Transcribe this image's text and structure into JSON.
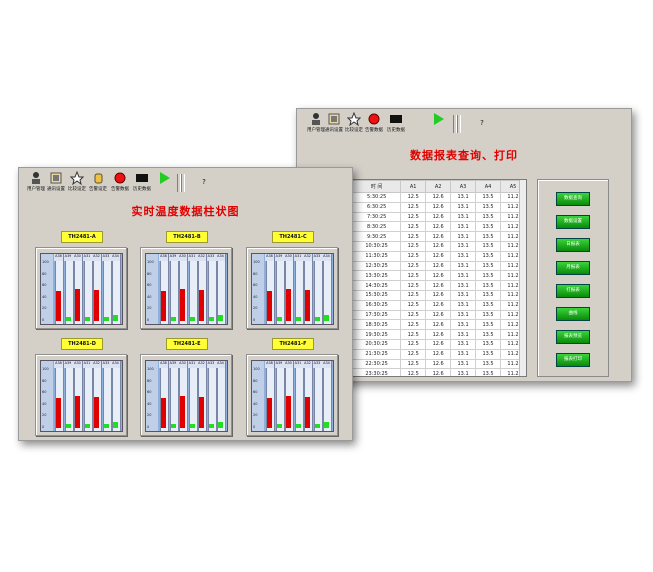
{
  "toolbar_back": {
    "buttons": [
      {
        "label": "用户管理",
        "icon": "user-icon"
      },
      {
        "label": "通讯设置",
        "icon": "comm-settings-icon"
      },
      {
        "label": "比较设定",
        "icon": "star-icon"
      },
      {
        "label": "告警数据",
        "icon": "alarm-icon"
      },
      {
        "label": "历史数据",
        "icon": "history-icon"
      }
    ]
  },
  "toolbar_front": {
    "buttons": [
      {
        "label": "用户管理",
        "icon": "user-icon"
      },
      {
        "label": "通讯设置",
        "icon": "comm-settings-icon"
      },
      {
        "label": "比较设定",
        "icon": "star-icon"
      },
      {
        "label": "告警设定",
        "icon": "hand-icon"
      },
      {
        "label": "告警数据",
        "icon": "alarm-icon"
      },
      {
        "label": "历史数据",
        "icon": "history-icon"
      }
    ],
    "help": "?"
  },
  "report": {
    "title": "数据报表查询、打印",
    "columns": [
      "时 间",
      "A1",
      "A2",
      "A3",
      "A4",
      "A5"
    ],
    "rows": [
      [
        "5:30:25",
        "12.5",
        "12.6",
        "13.1",
        "13.5",
        "11.2"
      ],
      [
        "6:30:25",
        "12.5",
        "12.6",
        "13.1",
        "13.5",
        "11.2"
      ],
      [
        "7:30:25",
        "12.5",
        "12.6",
        "13.1",
        "13.5",
        "11.2"
      ],
      [
        "8:30:25",
        "12.5",
        "12.6",
        "13.1",
        "13.5",
        "11.2"
      ],
      [
        "9:30:25",
        "12.5",
        "12.6",
        "13.1",
        "13.5",
        "11.2"
      ],
      [
        "10:30:25",
        "12.5",
        "12.6",
        "13.1",
        "13.5",
        "11.2"
      ],
      [
        "11:30:25",
        "12.5",
        "12.6",
        "13.1",
        "13.5",
        "11.2"
      ],
      [
        "12:30:25",
        "12.5",
        "12.6",
        "13.1",
        "13.5",
        "11.2"
      ],
      [
        "13:30:25",
        "12.5",
        "12.6",
        "13.1",
        "13.5",
        "11.2"
      ],
      [
        "14:30:25",
        "12.5",
        "12.6",
        "13.1",
        "13.5",
        "11.2"
      ],
      [
        "15:30:25",
        "12.5",
        "12.6",
        "13.1",
        "13.5",
        "11.2"
      ],
      [
        "16:30:25",
        "12.5",
        "12.6",
        "13.1",
        "13.5",
        "11.2"
      ],
      [
        "17:30:25",
        "12.5",
        "12.6",
        "13.1",
        "13.5",
        "11.2"
      ],
      [
        "18:30:25",
        "12.5",
        "12.6",
        "13.1",
        "13.5",
        "11.2"
      ],
      [
        "19:30:25",
        "12.5",
        "12.6",
        "13.1",
        "13.5",
        "11.2"
      ],
      [
        "20:30:25",
        "12.5",
        "12.6",
        "13.1",
        "13.5",
        "11.2"
      ],
      [
        "21:30:25",
        "12.5",
        "12.6",
        "13.1",
        "13.5",
        "11.2"
      ],
      [
        "22:30:25",
        "12.5",
        "12.6",
        "13.1",
        "13.5",
        "11.2"
      ],
      [
        "23:30:25",
        "12.5",
        "12.6",
        "13.1",
        "13.5",
        "11.2"
      ],
      [
        "",
        "",
        "",
        "",
        "",
        ""
      ]
    ],
    "buttons": [
      "数据查询",
      "数据设置",
      "日报表",
      "月报表",
      "打报表",
      "曲线",
      "报表预览",
      "报表打印"
    ]
  },
  "bar_view": {
    "title": "实时温度数据柱状图",
    "channels": [
      "A38",
      "A39",
      "A30",
      "A31",
      "A32",
      "A33",
      "A34"
    ],
    "y_ticks": [
      "100",
      "80",
      "60",
      "40",
      "20",
      "0"
    ],
    "colors": {
      "red": "#e00000",
      "green": "#22dd22"
    },
    "panels": [
      {
        "label": "TH2481-A",
        "values": [
          52,
          2,
          55,
          3,
          54,
          2,
          20
        ]
      },
      {
        "label": "TH2481-B",
        "values": [
          52,
          2,
          55,
          3,
          54,
          2,
          20
        ]
      },
      {
        "label": "TH2481-C",
        "values": [
          52,
          2,
          55,
          3,
          54,
          2,
          20
        ]
      },
      {
        "label": "TH2481-D",
        "values": [
          52,
          2,
          55,
          3,
          54,
          2,
          20
        ]
      },
      {
        "label": "TH2481-E",
        "values": [
          52,
          2,
          55,
          3,
          54,
          2,
          20
        ]
      },
      {
        "label": "TH2481-F",
        "values": [
          52,
          2,
          55,
          3,
          54,
          2,
          20
        ]
      }
    ]
  }
}
